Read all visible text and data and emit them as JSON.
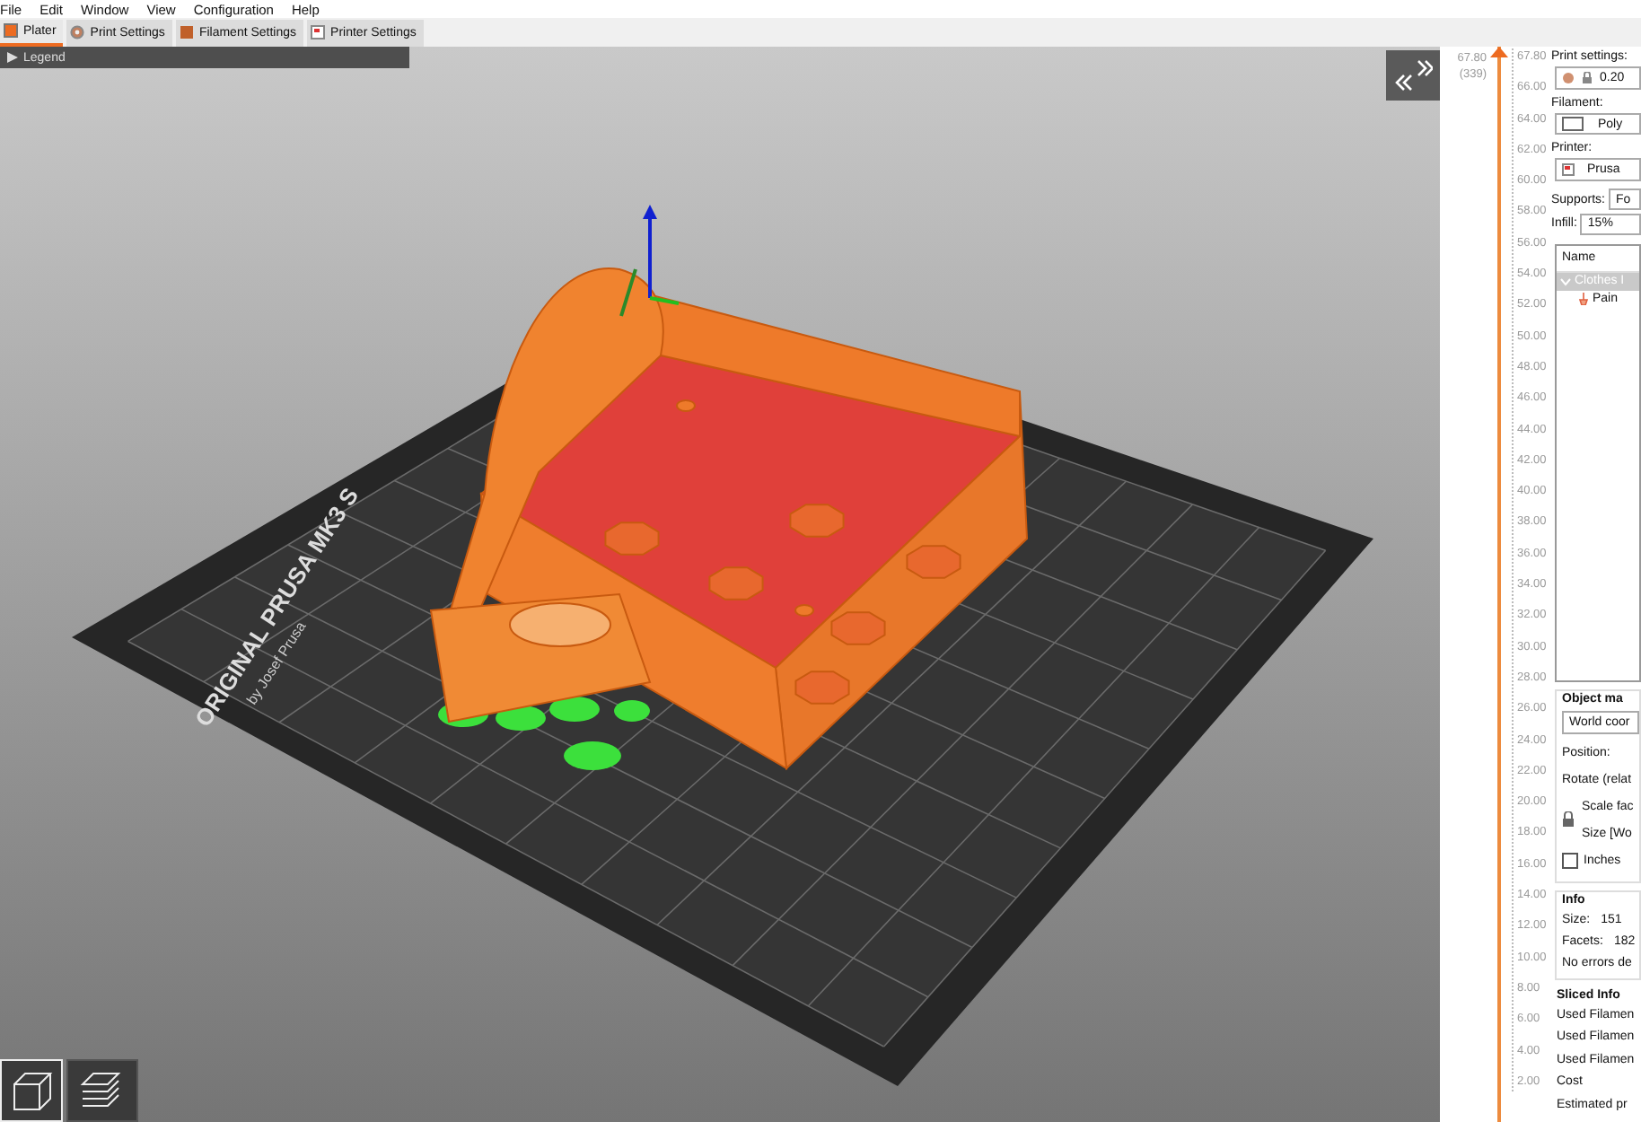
{
  "menu": [
    "File",
    "Edit",
    "Window",
    "View",
    "Configuration",
    "Help"
  ],
  "tabs": [
    {
      "label": "Plater",
      "selected": true,
      "kind": "plater"
    },
    {
      "label": "Print Settings",
      "selected": false,
      "kind": "print"
    },
    {
      "label": "Filament Settings",
      "selected": false,
      "kind": "filament"
    },
    {
      "label": "Printer Settings",
      "selected": false,
      "kind": "printer"
    }
  ],
  "viewport": {
    "legend": {
      "label": "Legend",
      "expanded": false
    },
    "bed_logo": {
      "title": "ORIGINAL PRUSA MK3 S",
      "subtitle": "by Josef Prusa"
    }
  },
  "layer_slider": {
    "top_value": "67.80",
    "top_layer": "(339)",
    "level": 1,
    "ticks": [
      "67.80",
      "66.00",
      "64.00",
      "62.00",
      "60.00",
      "58.00",
      "56.00",
      "54.00",
      "52.00",
      "50.00",
      "48.00",
      "46.00",
      "44.00",
      "42.00",
      "40.00",
      "38.00",
      "36.00",
      "34.00",
      "32.00",
      "30.00",
      "28.00",
      "26.00",
      "24.00",
      "22.00",
      "20.00",
      "18.00",
      "16.00",
      "14.00",
      "12.00",
      "10.00",
      "8.00",
      "6.00",
      "4.00",
      "2.00"
    ]
  },
  "sidebar": {
    "print_settings": {
      "label": "Print settings:",
      "value": "0.20"
    },
    "filament": {
      "label": "Filament:",
      "value": "Poly"
    },
    "printer": {
      "label": "Printer:",
      "value": "Prusa"
    },
    "supports": {
      "label": "Supports:",
      "value": "Fo"
    },
    "infill": {
      "label": "Infill:",
      "value": "15%"
    },
    "object_list": {
      "header": "Name",
      "items": [
        {
          "label": "Clothes I",
          "selected": true,
          "expanded": true,
          "children": [
            {
              "label": "Pain",
              "selected": false
            }
          ]
        }
      ]
    },
    "object_manipulation": {
      "title": "Object ma",
      "coordinates": "World coor",
      "position": "Position:",
      "rotate": "Rotate (relat",
      "scale": "Scale fac",
      "size": "Size [Wo",
      "inches": {
        "label": "Inches",
        "checked": false
      }
    },
    "info": {
      "title": "Info",
      "rows": [
        {
          "label": "Size:",
          "value": "151"
        },
        {
          "label": "Facets:",
          "value": "182"
        }
      ],
      "note": "No errors de"
    },
    "sliced_info": {
      "title": "Sliced Info",
      "rows": [
        "Used Filamen",
        "Used Filamen",
        "Used Filamen",
        "Cost",
        "Estimated pr"
      ]
    }
  }
}
